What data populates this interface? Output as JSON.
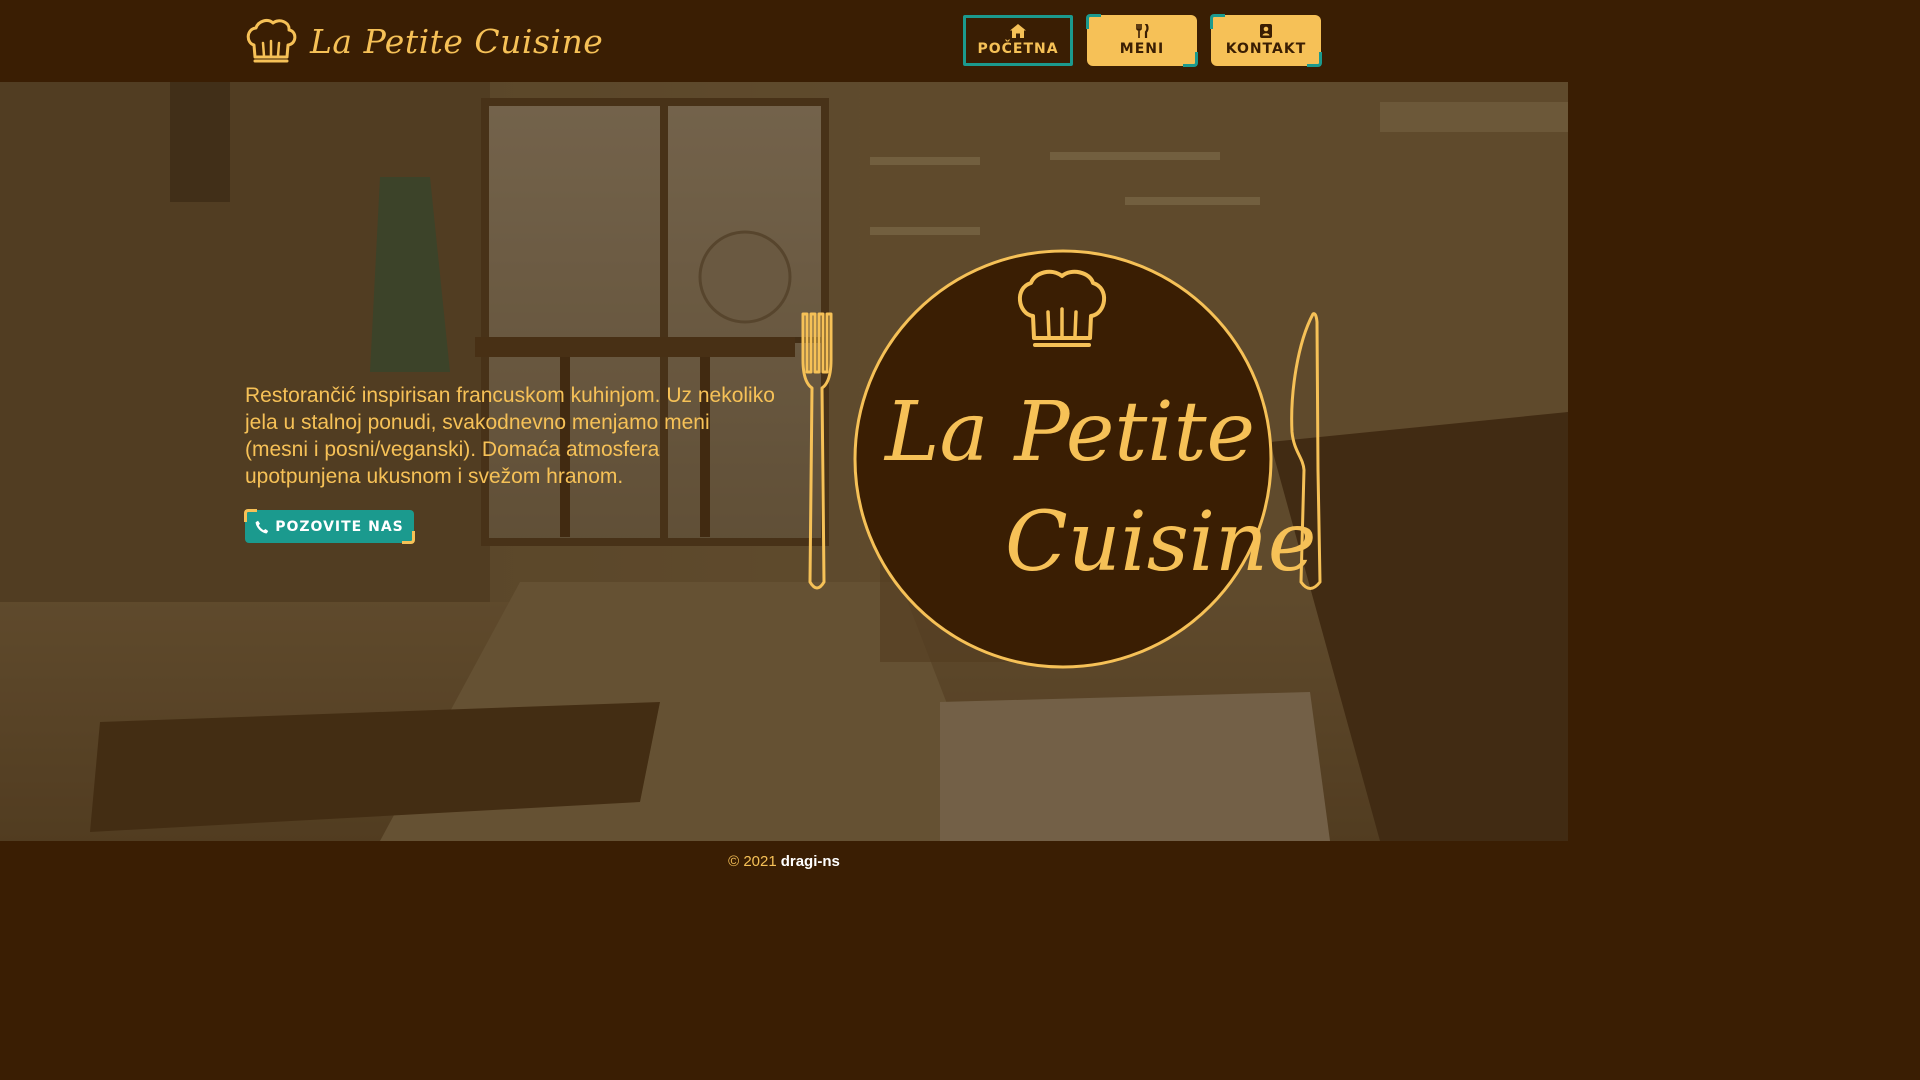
{
  "header": {
    "brand_name": "La Petite Cuisine",
    "brand_icon": "chef-hat-icon",
    "nav": [
      {
        "label": "POČETNA",
        "icon": "home-icon",
        "active": true
      },
      {
        "label": "MENI",
        "icon": "utensils-icon",
        "active": false
      },
      {
        "label": "KONTAKT",
        "icon": "contact-card-icon",
        "active": false
      }
    ]
  },
  "hero": {
    "description": "Restorančić inspirisan francuskom kuhinjom. Uz nekoliko jela u stalnoj ponudi, svakodnevno menjamo meni (mesni i posni/veganski). Domaća atmosfera upotpunjena ukusnom i svežom hranom.",
    "call_button": {
      "label": "POZOVITE NAS",
      "icon": "phone-icon"
    },
    "plate_logo": {
      "line1": "La Petite",
      "line2": "Cuisine",
      "icons": [
        "chef-hat-icon",
        "fork-icon",
        "knife-icon"
      ]
    }
  },
  "footer": {
    "copyright": "© 2021",
    "author": "dragi-ns"
  },
  "colors": {
    "brown": "#3a1e03",
    "gold": "#f6c157",
    "teal": "#1b9a8e"
  }
}
